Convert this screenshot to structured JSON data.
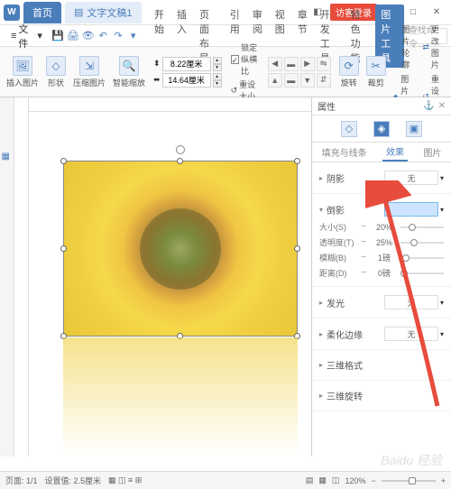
{
  "titlebar": {
    "home_tab": "首页",
    "doc_tab": "文字文稿1",
    "login": "访客登录"
  },
  "menubar": {
    "file": "文件",
    "tabs": [
      "开始",
      "插入",
      "页面布局",
      "引用",
      "审阅",
      "视图",
      "章节",
      "开发工具",
      "特色功能",
      "图片工具"
    ],
    "search_placeholder": "查找命令..."
  },
  "ribbon": {
    "insert_pic": "插入图片",
    "shape": "形状",
    "compress": "压缩图片",
    "smart_zoom": "智能缩放",
    "width_val": "8.22厘米",
    "height_val": "14.64厘米",
    "lock_ratio": "锁定纵横比",
    "reset_size": "重设大小",
    "rotate": "旋转",
    "crop": "裁剪",
    "pic_contour": "图片轮廓",
    "pic_effect": "图片效果",
    "change_pic": "更改图片",
    "reset_pic": "重设图片"
  },
  "props": {
    "title": "属性",
    "subtabs": [
      "填充与线条",
      "效果",
      "图片"
    ],
    "shadow": {
      "label": "阴影",
      "value": "无"
    },
    "reflection": {
      "label": "倒影",
      "size": {
        "label": "大小(S)",
        "value": "20%"
      },
      "transparency": {
        "label": "透明度(T)",
        "value": "25%"
      },
      "blur": {
        "label": "模糊(B)",
        "value": "1磅"
      },
      "distance": {
        "label": "距离(D)",
        "value": "0磅"
      }
    },
    "glow": {
      "label": "发光",
      "value": "无"
    },
    "soft_edge": {
      "label": "柔化边缘",
      "value": "无"
    },
    "threed_format": "三维格式",
    "threed_rotate": "三维旋转"
  },
  "statusbar": {
    "page": "页面: 1/1",
    "section": "设置值: 2.5厘米",
    "zoom": "120%"
  },
  "watermark": "百度经验"
}
